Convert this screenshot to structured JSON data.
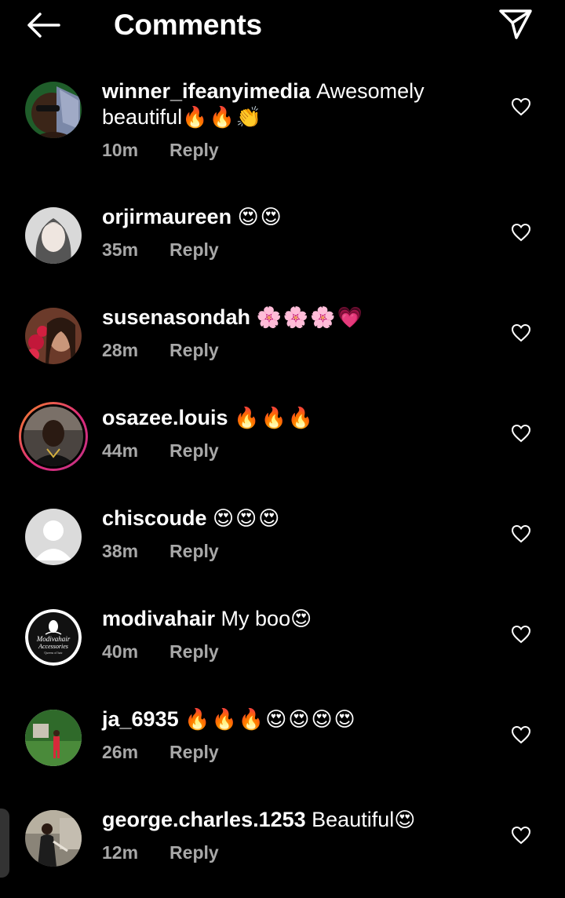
{
  "header": {
    "title": "Comments",
    "back_icon": "arrow-left-icon",
    "share_icon": "paper-plane-icon"
  },
  "colors": {
    "background": "#000000",
    "text": "#ffffff",
    "meta_text": "#a8a8a8",
    "story_ring_start": "#f58529",
    "story_ring_end": "#c13584"
  },
  "comments": [
    {
      "username": "winner_ifeanyimedia",
      "text": "Awesomely beautiful",
      "emojis": "🔥🔥👏",
      "time": "10m",
      "reply_label": "Reply",
      "icon": "heart-outline-icon"
    },
    {
      "username": "orjirmaureen",
      "text": "",
      "emojis": "😍😍",
      "time": "35m",
      "reply_label": "Reply",
      "icon": "heart-outline-icon"
    },
    {
      "username": "susenasondah",
      "text": "",
      "emojis": "🌸🌸🌸💗",
      "time": "28m",
      "reply_label": "Reply",
      "icon": "heart-outline-icon"
    },
    {
      "username": "osazee.louis",
      "text": "",
      "emojis": "🔥🔥🔥",
      "time": "44m",
      "reply_label": "Reply",
      "icon": "heart-outline-icon"
    },
    {
      "username": "chiscoude",
      "text": "",
      "emojis": "😍😍😍",
      "time": "38m",
      "reply_label": "Reply",
      "icon": "heart-outline-icon"
    },
    {
      "username": "modivahair",
      "text": "My boo",
      "emojis": "😍",
      "time": "40m",
      "reply_label": "Reply",
      "icon": "heart-outline-icon"
    },
    {
      "username": "ja_6935",
      "text": "",
      "emojis": "🔥🔥🔥😍😍😍😍",
      "time": "26m",
      "reply_label": "Reply",
      "icon": "heart-outline-icon"
    },
    {
      "username": "george.charles.1253",
      "text": "Beautiful",
      "emojis": "😍",
      "time": "12m",
      "reply_label": "Reply",
      "icon": "heart-outline-icon"
    }
  ],
  "modivahair_logo": {
    "line1": "Modivahair",
    "line2": "Accessories",
    "line3": "Queens of hair"
  }
}
